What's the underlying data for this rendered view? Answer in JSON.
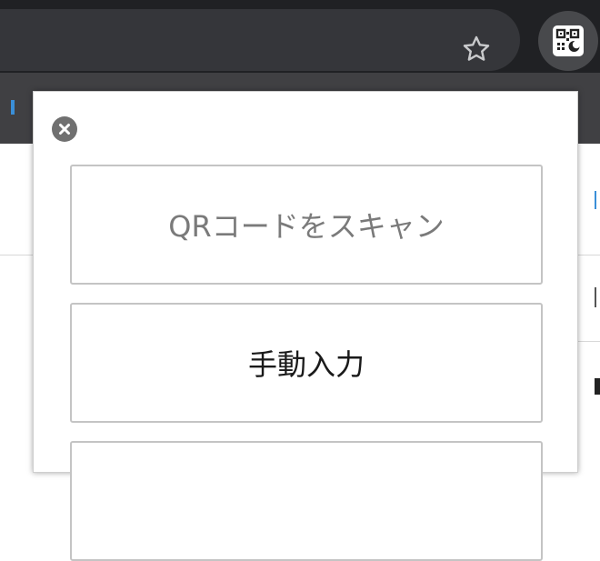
{
  "toolbar": {
    "bookmark_icon": "star-outline-icon",
    "extension_icon": "qr-code-icon"
  },
  "popup": {
    "close_icon": "close-circle-icon",
    "buttons": {
      "scan_label": "QRコードをスキャン",
      "manual_label": "手動入力",
      "third_label": ""
    }
  },
  "colors": {
    "browser_frame": "#202124",
    "omnibox": "#35363a",
    "extension_button": "#48494c",
    "popup_border": "#c4c4c4",
    "close_button": "#707070",
    "scan_text": "#7a7a7a",
    "manual_text": "#1a1a1a",
    "page_accent": "#3a8fd8"
  }
}
